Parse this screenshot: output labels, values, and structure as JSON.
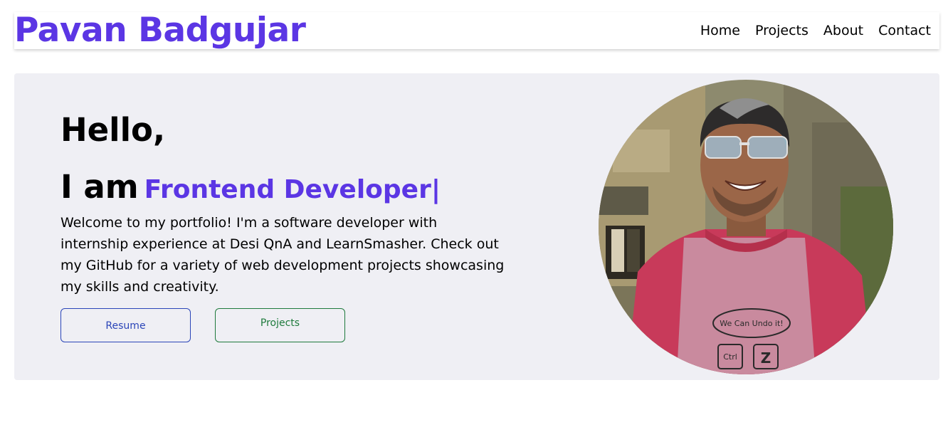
{
  "navbar": {
    "brand": "Pavan Badgujar",
    "links": [
      "Home",
      "Projects",
      "About",
      "Contact"
    ]
  },
  "hero": {
    "greeting": "Hello,",
    "iam": "I am",
    "role": "Frontend Developer",
    "cursor": "|",
    "intro": "Welcome to my portfolio! I'm a software developer with internship experience at Desi QnA and LearnSmasher. Check out my GitHub for a variety of web development projects showcasing my skills and creativity.",
    "buttons": {
      "resume": "Resume",
      "projects": "Projects"
    },
    "photo": {
      "shirt_text": "We Can Undo it!",
      "key_left": "Ctrl",
      "key_right": "Z"
    }
  },
  "colors": {
    "accent": "#5b36e4",
    "hero_bg": "#efeff4",
    "resume_border": "#2b45b8",
    "projects_border": "#1e7a3c"
  }
}
